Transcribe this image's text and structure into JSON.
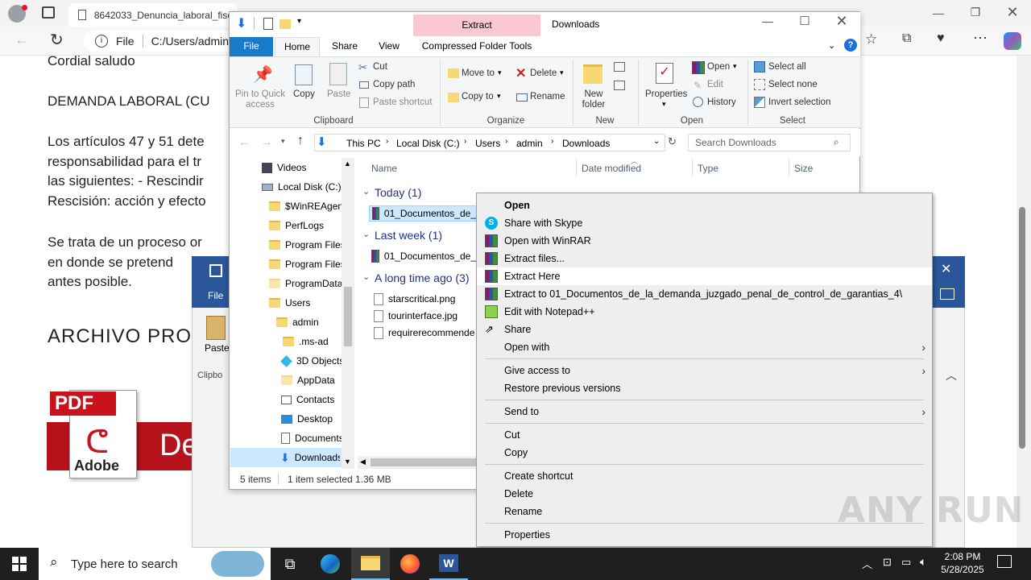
{
  "browser": {
    "tab_title": "8642033_Denuncia_laboral_fisca",
    "address": "C:/Users/admin/",
    "file_label": "File"
  },
  "document": {
    "lines": [
      "Cordial saludo",
      "DEMANDA LABORAL (CU",
      "Los artículos 47 y 51 dete",
      "responsabilidad para el tr",
      "las siguientes: - Rescindir",
      "Rescisión: acción y efecto",
      "Se trata de un proceso or",
      "en donde se pretend",
      "antes posible.",
      "ARCHIVO PRO"
    ],
    "logo_text": "PDF",
    "logo_brand": "Adobe",
    "logo_trailing": "De"
  },
  "word": {
    "file_tab": "File",
    "paste_label": "Paste",
    "clipboard_label": "Clipbo"
  },
  "explorer": {
    "title": "Downloads",
    "extract_tab": "Extract",
    "ribbon_tabs": [
      "File",
      "Home",
      "Share",
      "View",
      "Compressed Folder Tools"
    ],
    "clipboard": {
      "pin": "Pin to Quick access",
      "copy": "Copy",
      "paste": "Paste",
      "cut": "Cut",
      "copy_path": "Copy path",
      "paste_shortcut": "Paste shortcut",
      "group": "Clipboard"
    },
    "organize": {
      "move_to": "Move to",
      "copy_to": "Copy to",
      "delete": "Delete",
      "rename": "Rename",
      "group": "Organize"
    },
    "new": {
      "new_folder": "New folder",
      "group": "New"
    },
    "open": {
      "properties": "Properties",
      "open": "Open",
      "edit": "Edit",
      "history": "History",
      "group": "Open"
    },
    "select": {
      "select_all": "Select all",
      "select_none": "Select none",
      "invert": "Invert selection",
      "group": "Select"
    },
    "breadcrumb": [
      "This PC",
      "Local Disk (C:)",
      "Users",
      "admin",
      "Downloads"
    ],
    "search_placeholder": "Search Downloads",
    "nav_items": [
      "Videos",
      "Local Disk (C:)",
      "$WinREAgent",
      "PerfLogs",
      "Program Files",
      "Program Files",
      "ProgramData",
      "Users",
      "admin",
      ".ms-ad",
      "3D Objects",
      "AppData",
      "Contacts",
      "Desktop",
      "Documents",
      "Downloads"
    ],
    "columns": [
      "Name",
      "Date modified",
      "Type",
      "Size"
    ],
    "groups": [
      {
        "label": "Today (1)",
        "files": [
          "01_Documentos_de_"
        ]
      },
      {
        "label": "Last week (1)",
        "files": [
          "01_Documentos_de_"
        ]
      },
      {
        "label": "A long time ago (3)",
        "files": [
          "starscritical.png",
          "tourinterface.jpg",
          "requirerecommende"
        ]
      }
    ],
    "status_items": "5 items",
    "status_selected": "1 item selected",
    "status_size": "1.36 MB"
  },
  "context_menu": [
    {
      "label": "Open",
      "bold": true
    },
    {
      "label": "Share with Skype"
    },
    {
      "label": "Open with WinRAR"
    },
    {
      "label": "Extract files..."
    },
    {
      "label": "Extract Here",
      "highlight": true
    },
    {
      "label": "Extract to 01_Documentos_de_la_demanda_juzgado_penal_de_control_de_garantias_4\\"
    },
    {
      "label": "Edit with Notepad++"
    },
    {
      "label": "Share"
    },
    {
      "label": "Open with"
    },
    {
      "label": "Give access to"
    },
    {
      "label": "Restore previous versions"
    },
    {
      "label": "Send to"
    },
    {
      "label": "Cut"
    },
    {
      "label": "Copy"
    },
    {
      "label": "Create shortcut"
    },
    {
      "label": "Delete"
    },
    {
      "label": "Rename"
    },
    {
      "label": "Properties"
    }
  ],
  "taskbar": {
    "search_placeholder": "Type here to search",
    "time": "2:08 PM",
    "date": "5/28/2025"
  },
  "watermark": "ANY RUN",
  "colors": {
    "accent": "#0078d4",
    "extract_tab": "#f9c8d3",
    "word_blue": "#2b579a",
    "taskbar": "#1f1f1f"
  }
}
